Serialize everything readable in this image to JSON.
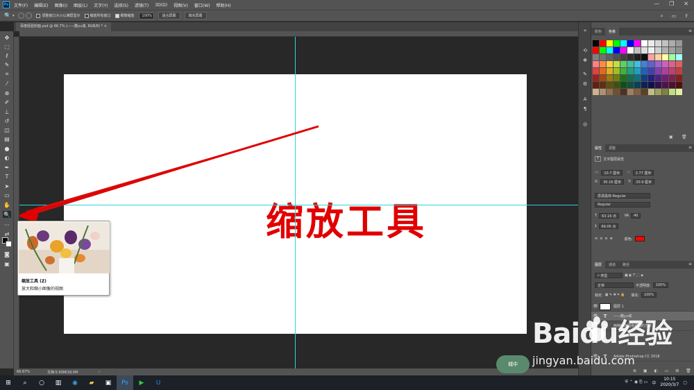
{
  "app": {
    "logo": "Ps"
  },
  "menu": [
    "文件(F)",
    "编辑(E)",
    "图像(I)",
    "图层(L)",
    "文字(Y)",
    "选择(S)",
    "滤镜(T)",
    "3D(D)",
    "视图(V)",
    "窗口(W)",
    "帮助(H)"
  ],
  "options": {
    "resize_windows": "调整窗口大小以满屏显示",
    "zoom_all": "缩放所有窗口",
    "scrubby_zoom": "细微缩放",
    "zoom_value": "100%",
    "fit_screen": "适合屏幕",
    "fill_screen": "填充屏幕"
  },
  "document": {
    "tab_title": "百度经验封面.psd @ 66.7% (——酷yu城, RGB/8) *",
    "big_text": "缩放工具"
  },
  "tooltip": {
    "title": "缩放工具 (Z)",
    "desc": "放大和缩小图像的视图"
  },
  "status": {
    "zoom": "66.67%",
    "doc_size": "文档:5.93M/18.5M"
  },
  "swatches_panel": {
    "tabs": [
      "颜色",
      "色板"
    ],
    "colors": [
      [
        "#000000",
        "#ff0000",
        "#ffff00",
        "#00ff00",
        "#00ffff",
        "#0000ff",
        "#ff00ff",
        "#ffffff",
        "#ebebeb",
        "#d6d6d6",
        "#c2c2c2",
        "#adadad",
        "#999999"
      ],
      [
        "#ff0000",
        "#00ff00",
        "#00ffff",
        "#0000ff",
        "#ff00ff",
        "#ffffff",
        "#c0c0c0",
        "#e0e0e0",
        "#f0f0f0",
        "#d0d0d0",
        "#b0b0b0",
        "#a0a0a0",
        "#909090"
      ],
      [
        "#808080",
        "#707070",
        "#606060",
        "#505050",
        "#404040",
        "#303030",
        "#202020",
        "#101010",
        "#ffa0a0",
        "#ffd0a0",
        "#ffffa0",
        "#a0ffa0",
        "#a0ffff"
      ],
      [
        "#ff8080",
        "#ff8c40",
        "#ffd040",
        "#c0e040",
        "#60d060",
        "#40c0a0",
        "#40c0e0",
        "#4080e0",
        "#6060d0",
        "#a060d0",
        "#d060c0",
        "#e06090",
        "#e06060"
      ],
      [
        "#e04040",
        "#e06a20",
        "#e0b020",
        "#a0c020",
        "#40b040",
        "#20a080",
        "#20a0c0",
        "#2060c0",
        "#4040b0",
        "#8040b0",
        "#b040a0",
        "#c04070",
        "#c04040"
      ],
      [
        "#a02020",
        "#a04a10",
        "#a07a10",
        "#708010",
        "#207020",
        "#107050",
        "#107080",
        "#104080",
        "#202080",
        "#502080",
        "#702070",
        "#802050",
        "#802020"
      ],
      [
        "#602010",
        "#603010",
        "#605010",
        "#405010",
        "#105010",
        "#105040",
        "#104050",
        "#102050",
        "#101050",
        "#301050",
        "#501050",
        "#501030",
        "#501010"
      ],
      [
        "#d0b090",
        "#b09070",
        "#907050",
        "#705030",
        "#503020",
        "#a08060",
        "#806040",
        "#604020",
        "#c0c080",
        "#a0a060",
        "#808040",
        "#c0e080",
        "#e0f0a0"
      ]
    ]
  },
  "properties_panel": {
    "tabs": [
      "属性",
      "调整"
    ],
    "header": "文字图层属性",
    "w": "10.7 厘米",
    "h": "2.77 厘米",
    "x": "30.16 厘米",
    "y": "20.9 厘米",
    "font": "思源黑体-Regular",
    "style": "Regular",
    "size": "63.16 点",
    "tracking": "40",
    "leading": "69.05 点",
    "color_label": "颜色:",
    "color_value": "#ff0000"
  },
  "layers_panel": {
    "tabs": [
      "图层",
      "通道",
      "路径"
    ],
    "kind": "类型",
    "blend": "正常",
    "opacity_label": "不透明度:",
    "opacity": "100%",
    "lock_label": "锁定:",
    "fill_label": "填充:",
    "fill": "100%",
    "layers": [
      {
        "name": "图层 1",
        "type": "pixel"
      },
      {
        "name": "——酷yu城",
        "type": "text"
      },
      {
        "name": "两种修改图像视图的方法",
        "type": "text"
      },
      {
        "name": "Adobe Photoshop CC 2018",
        "type": "text"
      }
    ]
  },
  "taskbar": {
    "time": "10:15",
    "date": "2020/3/7",
    "ime": "中"
  },
  "watermark": {
    "brand": "Baidu经验",
    "url": "jingyan.baidu.com",
    "badge": "城中"
  }
}
